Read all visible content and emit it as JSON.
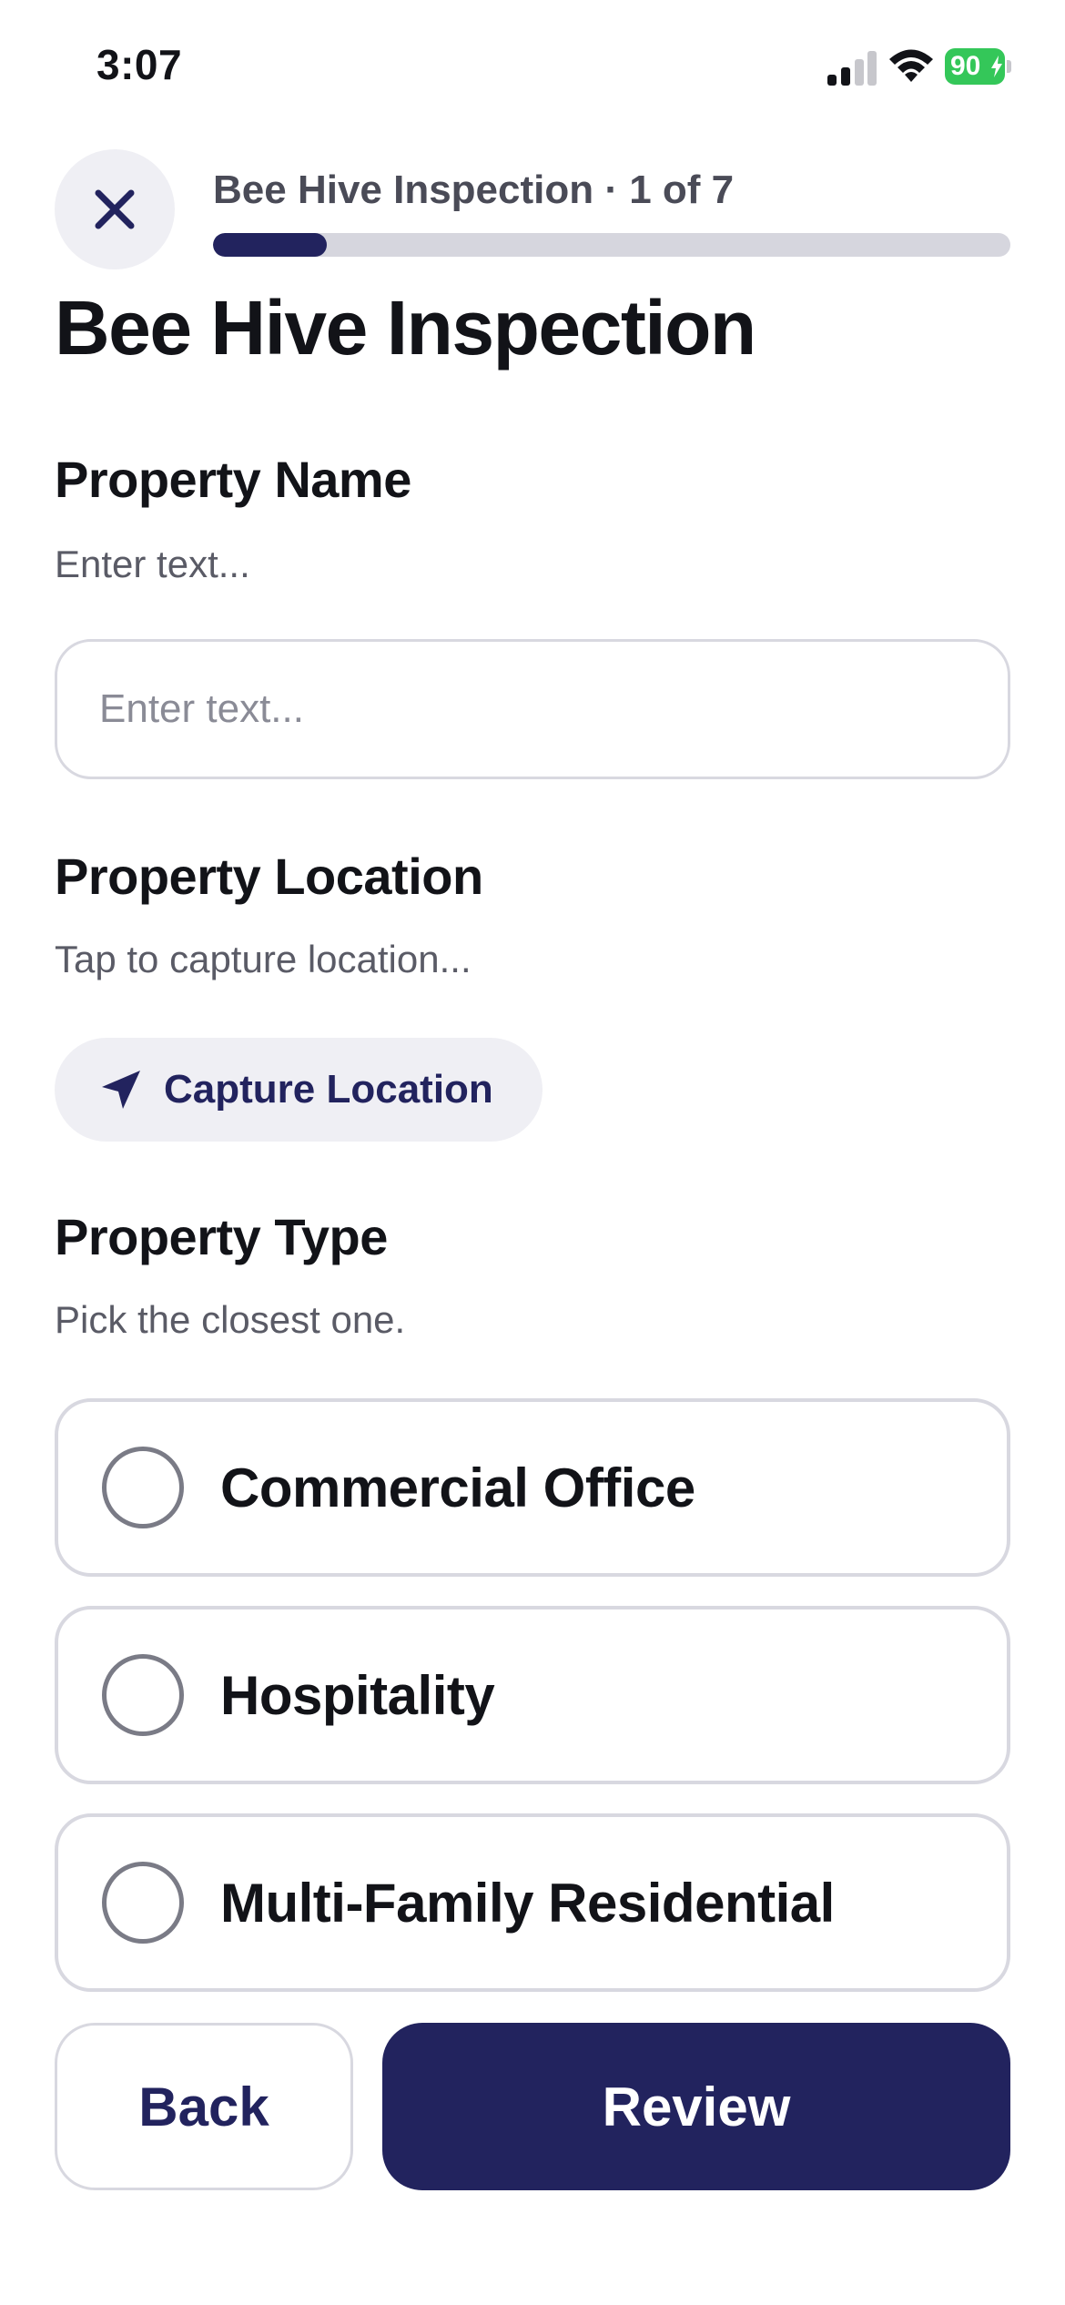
{
  "status_bar": {
    "time": "3:07",
    "battery_percent": "90",
    "battery_color": "#34c759",
    "icons": [
      "signal-icon",
      "wifi-icon",
      "battery-icon",
      "charging-bolt-icon"
    ]
  },
  "header": {
    "close_icon": "close-icon",
    "progress_label": "Bee Hive Inspection · 1 of 7",
    "progress_fraction": 0.1428
  },
  "page": {
    "title": "Bee Hive Inspection"
  },
  "property_name": {
    "label": "Property Name",
    "hint": "Enter text...",
    "value": "",
    "placeholder": "Enter text..."
  },
  "property_location": {
    "label": "Property Location",
    "hint": "Tap to capture location...",
    "button_label": "Capture Location",
    "button_icon": "location-arrow-icon"
  },
  "property_type": {
    "label": "Property Type",
    "hint": "Pick the closest one.",
    "options": [
      {
        "label": "Commercial Office",
        "selected": false
      },
      {
        "label": "Hospitality",
        "selected": false
      },
      {
        "label": "Multi-Family Residential",
        "selected": false
      }
    ]
  },
  "footer": {
    "back_label": "Back",
    "review_label": "Review"
  },
  "colors": {
    "accent": "#22235e",
    "border": "#d8d8e0",
    "chip_bg": "#efeff4"
  }
}
